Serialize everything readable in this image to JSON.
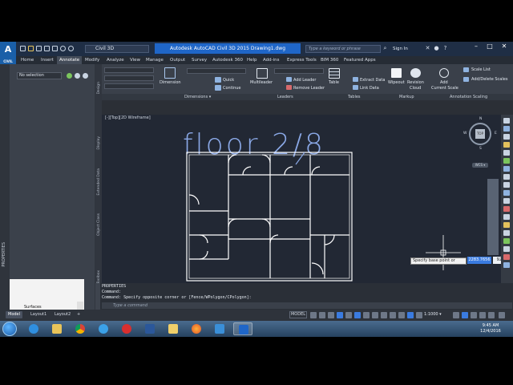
{
  "app": {
    "logo_text": "A",
    "logo_sub": "CIVIL",
    "workspace": "Civil 3D",
    "window_title": "Autodesk AutoCAD Civil 3D 2015   Drawing1.dwg",
    "search_placeholder": "Type a keyword or phrase",
    "sign_in": "Sign In",
    "window_controls": [
      "–",
      "□",
      "✕"
    ]
  },
  "ribbon_tabs": [
    "Home",
    "Insert",
    "Annotate",
    "Modify",
    "Analyze",
    "View",
    "Manage",
    "Output",
    "Survey",
    "Autodesk 360",
    "Help",
    "Add-ins",
    "Express Tools",
    "BIM 360",
    "Featured Apps"
  ],
  "active_tab": "Annotate",
  "ribbon": {
    "dimension_label": "Dimension",
    "quick_label": "Quick",
    "continue_label": "Continue",
    "multileader_label": "Multileader",
    "add_leader_label": "Add Leader",
    "remove_leader_label": "Remove Leader",
    "table_label": "Table",
    "extract_data_label": "Extract Data",
    "link_data_label": "Link Data",
    "wipeout_label": "Wipeout",
    "revision_cloud_label": "Revision",
    "revision_cloud_label2": "Cloud",
    "add_current_scale_label": "Add",
    "add_current_scale_label2": "Current Scale",
    "scale_list_label": "Scale List",
    "add_delete_scales_label": "Add/Delete Scales",
    "panels": [
      "Dimensions ▾",
      "Leaders",
      "Tables",
      "Markup",
      "Annotation Scaling"
    ]
  },
  "left_palette": {
    "selection": "No selection",
    "properties_label": "PROPERTIES",
    "tree_item": "Surfaces",
    "vertical_tabs": [
      "Design",
      "Display",
      "Extended Data",
      "Object Class",
      "Toolbox"
    ]
  },
  "canvas": {
    "viewport_label": "[-][Top][2D Wireframe]",
    "drawing_title": "floor 2/8",
    "viewcube_top": "TOP",
    "compass": {
      "n": "N",
      "s": "S",
      "e": "E",
      "w": "W"
    },
    "wcs": "WCS ▾",
    "prompt_tip": "Specify base point or",
    "coord1": "2283.7656",
    "coord2": "923.388",
    "view_controls": "– □ ✕",
    "ucs_label": "Y"
  },
  "command": {
    "history": [
      "PROPERTIES",
      "Command:",
      "Command: Specify opposite corner or [Fence/WPolygon/CPolygon]:"
    ],
    "input_placeholder": "Type a command"
  },
  "status": {
    "layout_tabs": [
      "Model",
      "Layout1",
      "Layout2"
    ],
    "active_layout": "Model",
    "add_tab": "+",
    "model_button": "MODEL",
    "scale": "1:1000 ▾"
  },
  "taskbar": {
    "time": "9:45 AM",
    "date": "12/4/2016"
  },
  "colors": {
    "accent": "#1f66c8",
    "canvas_bg": "#222834",
    "drawing_lines": "#ffffff",
    "title_text": "#8aa8e6"
  }
}
